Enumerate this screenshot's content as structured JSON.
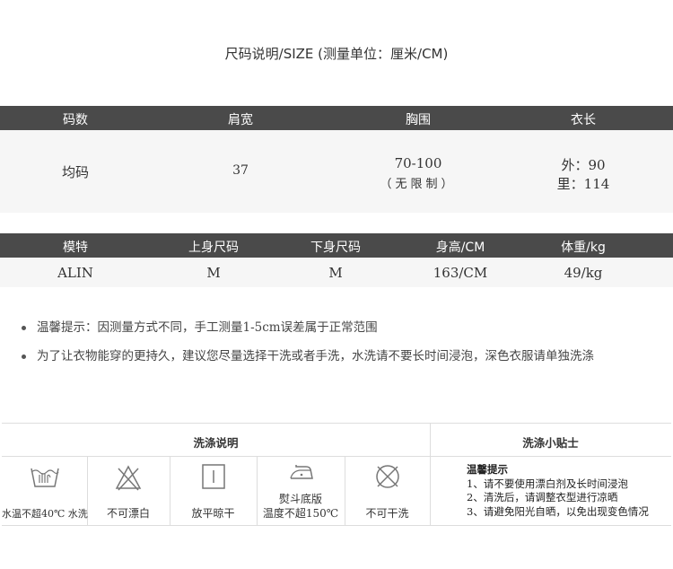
{
  "title": "尺码说明/SIZE (测量单位：厘米/CM)",
  "size_table": {
    "headers": [
      "码数",
      "肩宽",
      "胸围",
      "衣长"
    ],
    "row": {
      "size": "均码",
      "shoulder": "37",
      "chest_line1": "70-100",
      "chest_line2": "（无限制）",
      "length_line1": "外：90",
      "length_line2": "里：114"
    }
  },
  "model_table": {
    "headers": [
      "模特",
      "上身尺码",
      "下身尺码",
      "身高/CM",
      "体重/kg"
    ],
    "row": [
      "ALIN",
      "M",
      "M",
      "163/CM",
      "49/kg"
    ]
  },
  "notes": [
    "温馨提示：因测量方式不同，手工测量1-5cm误差属于正常范围",
    "为了让衣物能穿的更持久，建议您尽量选择干洗或者手洗，水洗请不要长时间浸泡，深色衣服请单独洗涤"
  ],
  "care": {
    "header_left": "洗涤说明",
    "header_right": "洗涤小贴士",
    "items": [
      {
        "icon": "hand-wash-icon",
        "label": "水温不超40℃ 水洗"
      },
      {
        "icon": "no-bleach-icon",
        "label": "不可漂白"
      },
      {
        "icon": "flat-dry-icon",
        "label": "放平晾干"
      },
      {
        "icon": "iron-icon",
        "label_line1": "熨斗底版",
        "label_line2": "温度不超150℃"
      },
      {
        "icon": "no-dry-clean-icon",
        "label": "不可干洗"
      }
    ],
    "tips_title": "温馨提示",
    "tips": [
      "1、请不要使用漂白剂及长时间浸泡",
      "2、清洗后，请调整衣型进行凉晒",
      "3、请避免阳光自晒，以免出现变色情况"
    ]
  }
}
